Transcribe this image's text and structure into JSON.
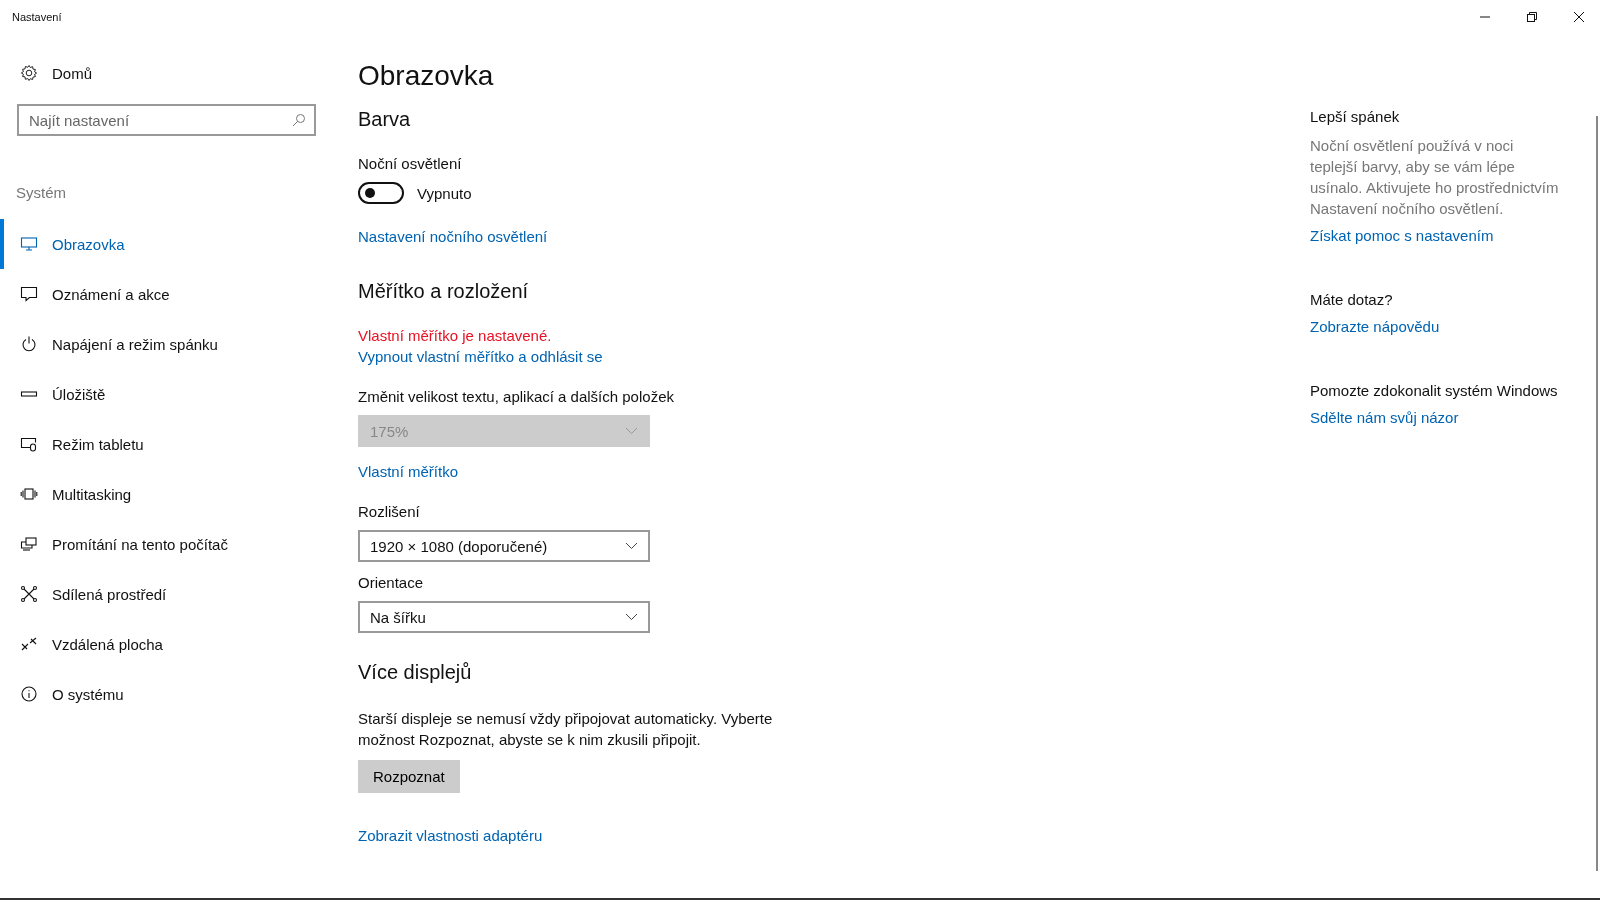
{
  "window": {
    "title": "Nastavení"
  },
  "sidebar": {
    "home": "Domů",
    "search": {
      "placeholder": "Najít nastavení"
    },
    "section": "Systém",
    "items": [
      {
        "label": "Obrazovka",
        "selected": true
      },
      {
        "label": "Oznámení a akce",
        "selected": false
      },
      {
        "label": "Napájení a režim spánku",
        "selected": false
      },
      {
        "label": "Úložiště",
        "selected": false
      },
      {
        "label": "Režim tabletu",
        "selected": false
      },
      {
        "label": "Multitasking",
        "selected": false
      },
      {
        "label": "Promítání na tento počítač",
        "selected": false
      },
      {
        "label": "Sdílená prostředí",
        "selected": false
      },
      {
        "label": "Vzdálená plocha",
        "selected": false
      },
      {
        "label": "O systému",
        "selected": false
      }
    ]
  },
  "page": {
    "title": "Obrazovka",
    "sections": [
      {
        "heading": "Barva",
        "items": [
          {
            "kind": "label",
            "text": "Noční osvětlení"
          },
          {
            "kind": "toggle",
            "on": false,
            "text": "Vypnuto"
          },
          {
            "kind": "link",
            "text": "Nastavení nočního osvětlení"
          }
        ]
      },
      {
        "heading": "Měřítko a rozložení",
        "items": [
          {
            "kind": "warning",
            "text": "Vlastní měřítko je nastavené."
          },
          {
            "kind": "link",
            "text": "Vypnout vlastní měřítko a odhlásit se"
          },
          {
            "kind": "label",
            "text": "Změnit velikost textu, aplikací a dalších položek"
          },
          {
            "kind": "dropdown",
            "value": "175%",
            "disabled": true
          },
          {
            "kind": "link",
            "text": "Vlastní měřítko"
          },
          {
            "kind": "label",
            "text": "Rozlišení"
          },
          {
            "kind": "dropdown",
            "value": "1920 × 1080 (doporučené)",
            "disabled": false
          },
          {
            "kind": "label",
            "text": "Orientace"
          },
          {
            "kind": "dropdown",
            "value": "Na šířku",
            "disabled": false
          }
        ]
      },
      {
        "heading": "Více displejů",
        "items": [
          {
            "kind": "paragraph",
            "text": "Starší displeje se nemusí vždy připojovat automaticky. Vyberte možnost Rozpoznat, abyste se k nim zkusili připojit."
          },
          {
            "kind": "button",
            "text": "Rozpoznat"
          },
          {
            "kind": "link",
            "text": "Zobrazit vlastnosti adaptéru"
          }
        ]
      }
    ]
  },
  "aside": [
    {
      "heading": "Lepší spánek",
      "text": "Noční osvětlení používá v noci teplejší barvy, aby se vám lépe usínalo. Aktivujete ho prostřednictvím Nastavení nočního osvětlení.",
      "link": "Získat pomoc s nastavením"
    },
    {
      "heading": "Máte dotaz?",
      "link": "Zobrazte nápovědu"
    },
    {
      "heading": "Pomozte zdokonalit systém Windows",
      "link": "Sdělte nám svůj názor"
    }
  ]
}
